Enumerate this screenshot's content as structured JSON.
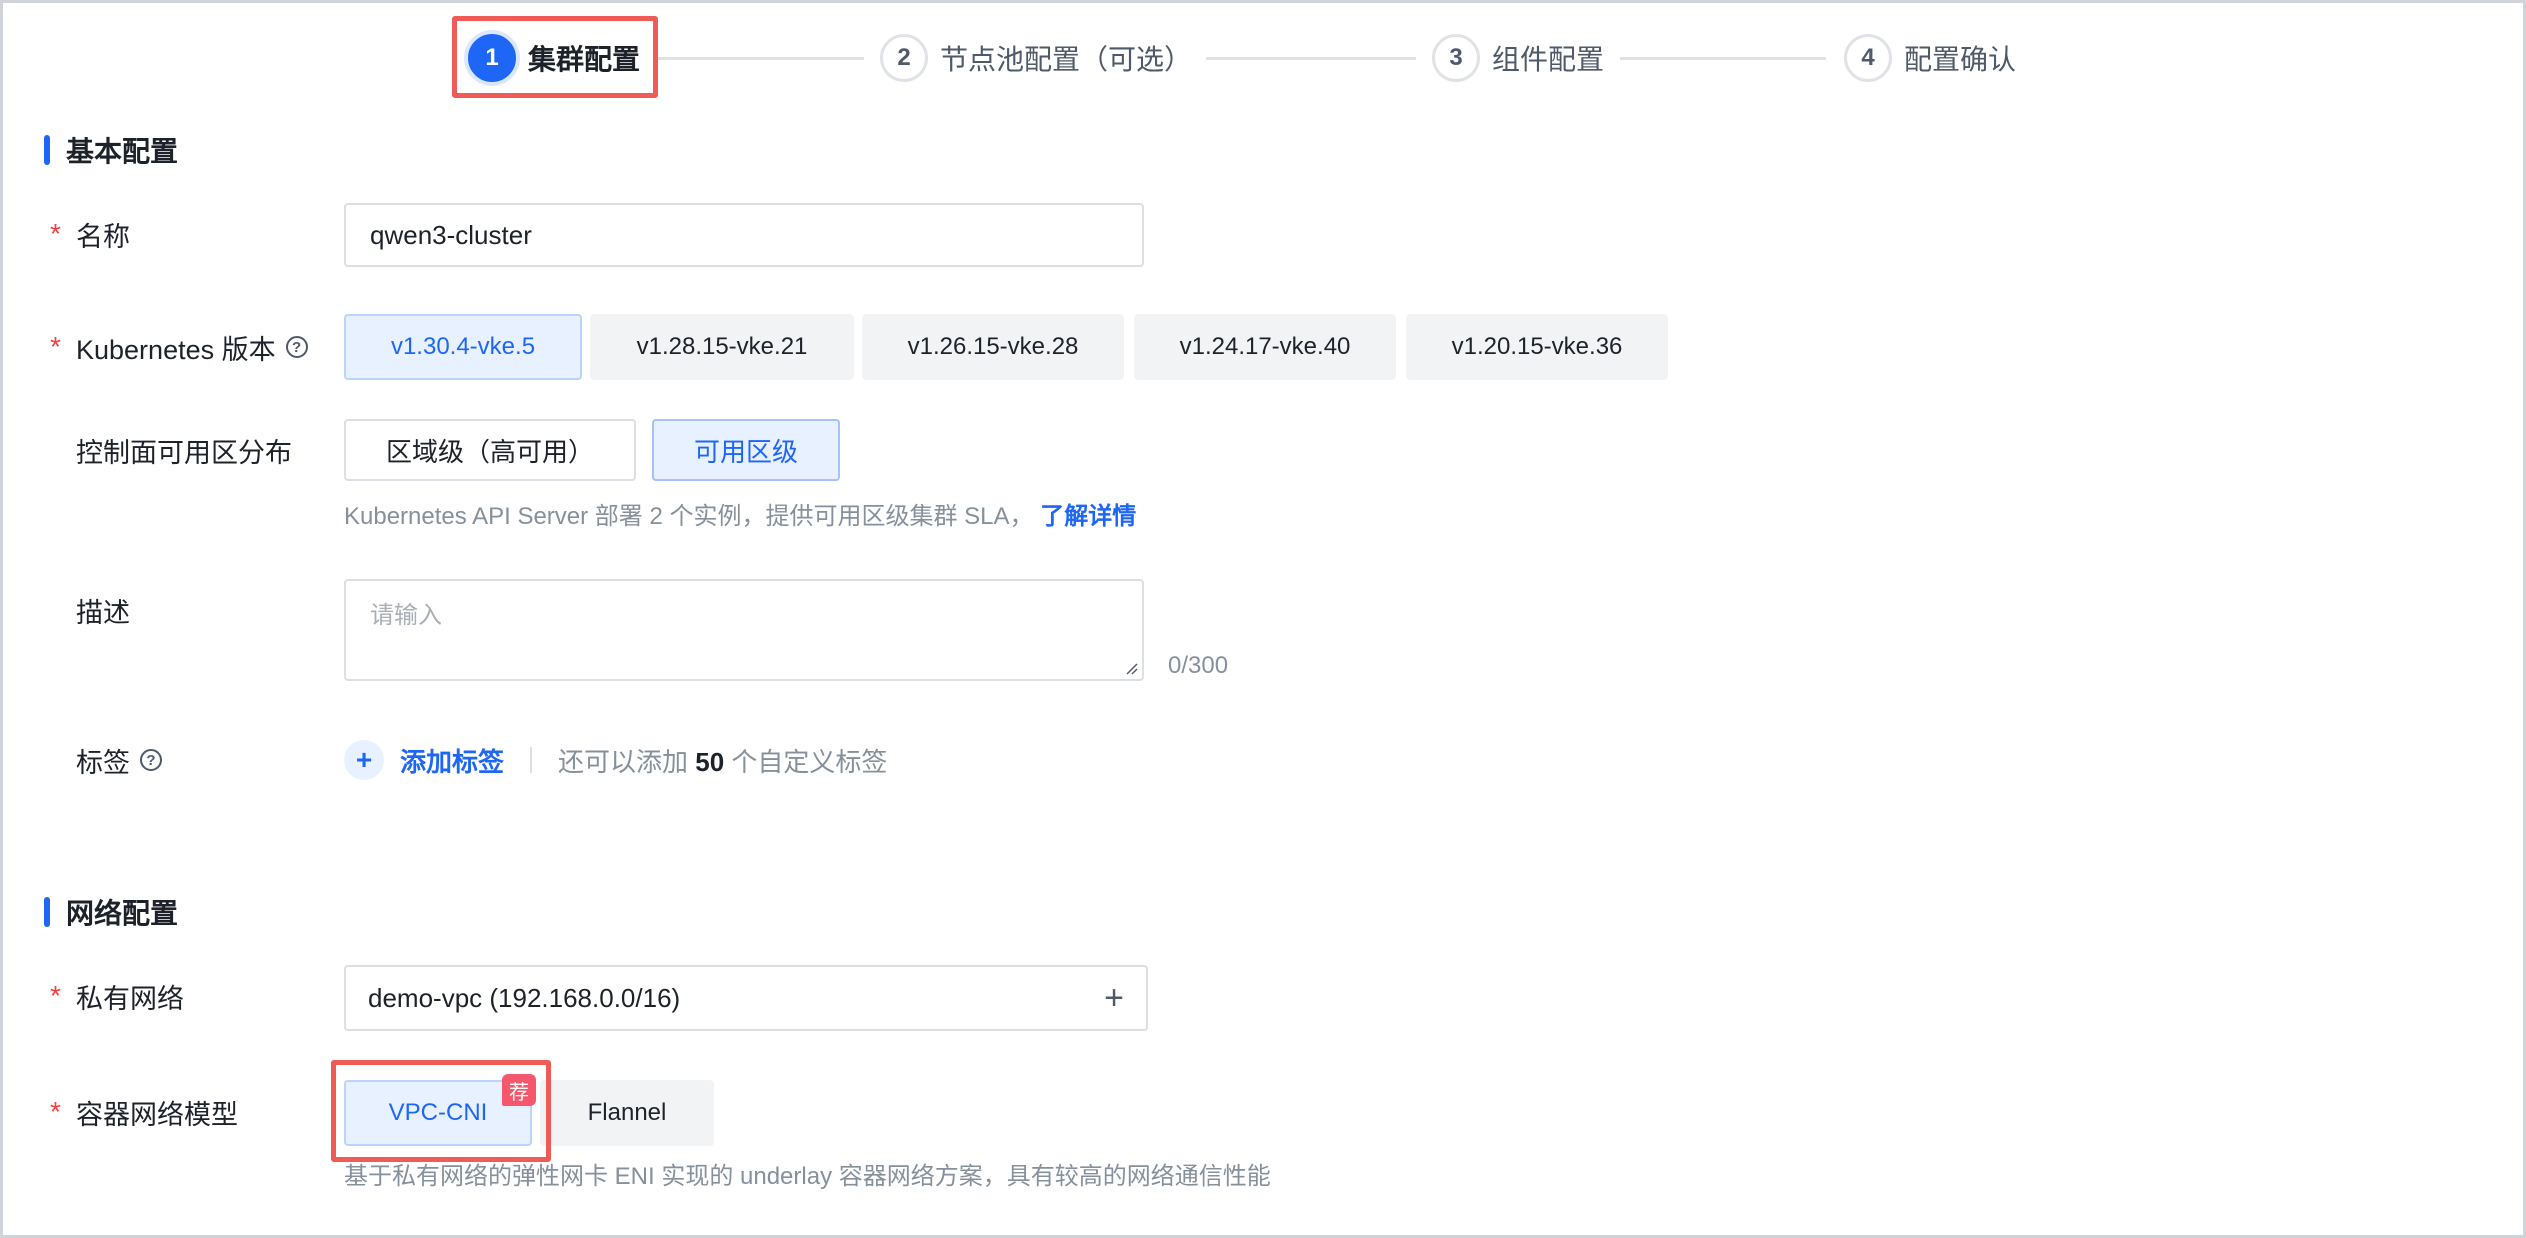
{
  "steps": [
    {
      "num": "1",
      "label": "集群配置"
    },
    {
      "num": "2",
      "label": "节点池配置（可选）"
    },
    {
      "num": "3",
      "label": "组件配置"
    },
    {
      "num": "4",
      "label": "配置确认"
    }
  ],
  "sections": {
    "basic": "基本配置",
    "network": "网络配置"
  },
  "form": {
    "name": {
      "required": "*",
      "label": "名称",
      "value": "qwen3-cluster"
    },
    "k8s": {
      "required": "*",
      "label": "Kubernetes 版本",
      "help_icon": "?",
      "options": [
        "v1.30.4-vke.5",
        "v1.28.15-vke.21",
        "v1.26.15-vke.28",
        "v1.24.17-vke.40",
        "v1.20.15-vke.36"
      ],
      "selected": "v1.30.4-vke.5"
    },
    "az": {
      "label": "控制面可用区分布",
      "options": [
        "区域级（高可用）",
        "可用区级"
      ],
      "selected": "可用区级",
      "hint": "Kubernetes API Server 部署 2 个实例，提供可用区级集群 SLA，",
      "hint_link": "了解详情"
    },
    "desc": {
      "label": "描述",
      "placeholder": "请输入",
      "counter": "0/300"
    },
    "tags": {
      "label": "标签",
      "help_icon": "?",
      "add_icon": "+",
      "add_label": "添加标签",
      "hint_pre": "还可以添加 ",
      "hint_count": "50",
      "hint_post": " 个自定义标签"
    },
    "vpc": {
      "required": "*",
      "label": "私有网络",
      "value": "demo-vpc (192.168.0.0/16)",
      "action_icon": "+"
    },
    "cni": {
      "required": "*",
      "label": "容器网络模型",
      "options": [
        "VPC-CNI",
        "Flannel"
      ],
      "selected": "VPC-CNI",
      "badge": "荐",
      "hint": "基于私有网络的弹性网卡 ENI 实现的 underlay 容器网络方案，具有较高的网络通信性能"
    }
  },
  "colors": {
    "accent": "#1e66f5",
    "required": "#f53f3f",
    "highlight": "#ef5b57",
    "badge": "#f5576c"
  }
}
